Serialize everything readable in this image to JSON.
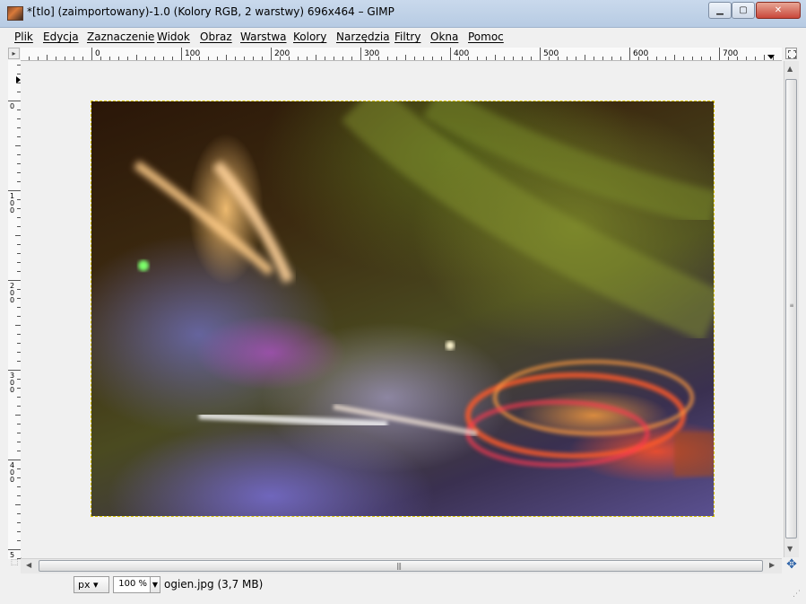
{
  "window": {
    "title": "*[tlo] (zaimportowany)-1.0 (Kolory RGB, 2 warstwy) 696x464 – GIMP",
    "buttons": {
      "minimize": "▁",
      "maximize": "▢",
      "close": "✕"
    }
  },
  "menu": {
    "items": [
      {
        "label": "Plik"
      },
      {
        "label": "Edycja"
      },
      {
        "label": "Zaznaczenie"
      },
      {
        "label": "Widok"
      },
      {
        "label": "Obraz"
      },
      {
        "label": "Warstwa"
      },
      {
        "label": "Kolory"
      },
      {
        "label": "Narzędzia"
      },
      {
        "label": "Filtry"
      },
      {
        "label": "Okna"
      },
      {
        "label": "Pomoc"
      }
    ]
  },
  "rulers": {
    "horizontal_labels": [
      "0",
      "100",
      "200",
      "300",
      "400",
      "500",
      "600",
      "700"
    ],
    "vertical_labels": [
      "0",
      "100",
      "200",
      "300",
      "400",
      "5"
    ],
    "corner_icon": "menu-arrow-icon"
  },
  "icons": {
    "navigate": "navigate-icon",
    "quick_mask": "quick-mask-icon",
    "zoom_fit": "zoom-fit-icon"
  },
  "statusbar": {
    "unit": "px",
    "zoom": "100 %",
    "file_info": "ogien.jpg (3,7 MB)"
  }
}
